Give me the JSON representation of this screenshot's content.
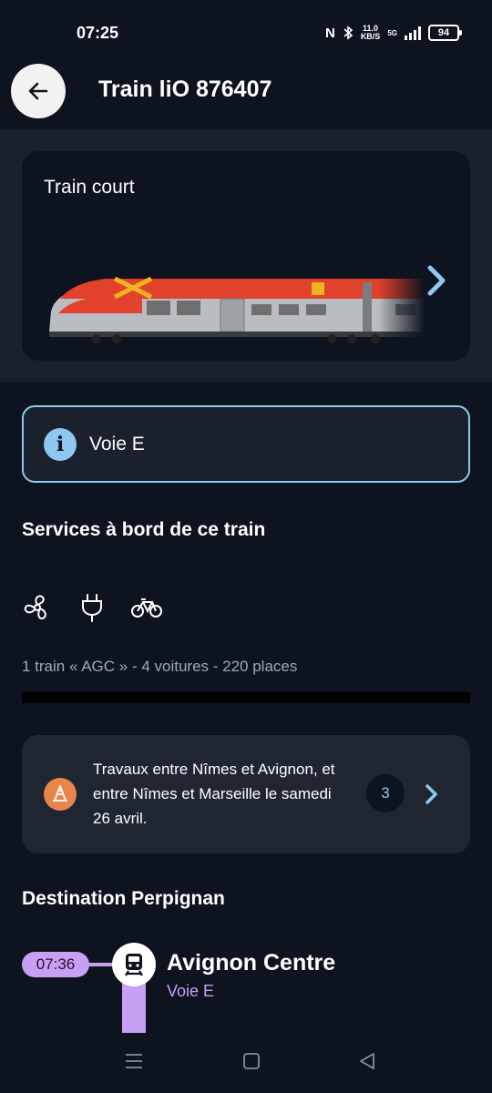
{
  "status_bar": {
    "time": "07:25",
    "nfc": "N",
    "speed_top": "11.0",
    "speed_unit": "KB/S",
    "network": "5G",
    "battery": "94"
  },
  "header": {
    "title": "Train liO 876407",
    "back_icon": "arrow-left-icon"
  },
  "train_card": {
    "label": "Train court",
    "chevron_icon": "chevron-right-icon"
  },
  "platform_info": {
    "icon": "info-icon",
    "icon_glyph": "i",
    "text": "Voie E"
  },
  "services": {
    "title": "Services à bord de ce train",
    "icons": [
      "air-conditioning-icon",
      "power-plug-icon",
      "bicycle-icon"
    ],
    "composition": "1 train « AGC » - 4 voitures - 220 places"
  },
  "works_alert": {
    "icon": "traffic-cone-icon",
    "text": "Travaux entre Nîmes et Avignon, et entre Nîmes et Marseille le samedi 26 avril.",
    "count": "3",
    "chevron_icon": "chevron-right-icon"
  },
  "destination": {
    "title": "Destination Perpignan",
    "stops": [
      {
        "time": "07:36",
        "station": "Avignon Centre",
        "track": "Voie E"
      }
    ]
  },
  "colors": {
    "background": "#0d131f",
    "accent_blue": "#8ec8f0",
    "accent_purple": "#c7a0f5",
    "alert_orange": "#e8854a"
  }
}
